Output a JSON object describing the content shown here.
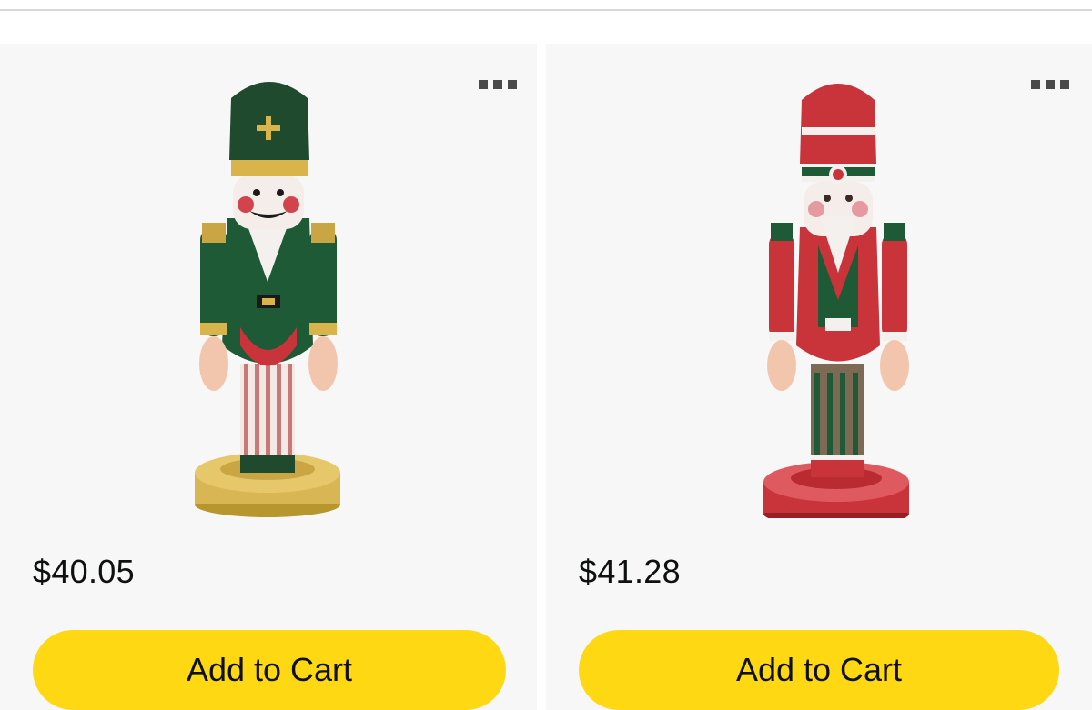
{
  "products": [
    {
      "image_icon": "green-nutcracker-image",
      "price": "$40.05",
      "add_to_cart_label": "Add to Cart",
      "more_icon": "more-options-icon"
    },
    {
      "image_icon": "red-nutcracker-image",
      "price": "$41.28",
      "add_to_cart_label": "Add to Cart",
      "more_icon": "more-options-icon"
    }
  ],
  "colors": {
    "button_yellow": "#FFD814",
    "card_background": "#F7F7F8",
    "text_primary": "#0F1111"
  }
}
